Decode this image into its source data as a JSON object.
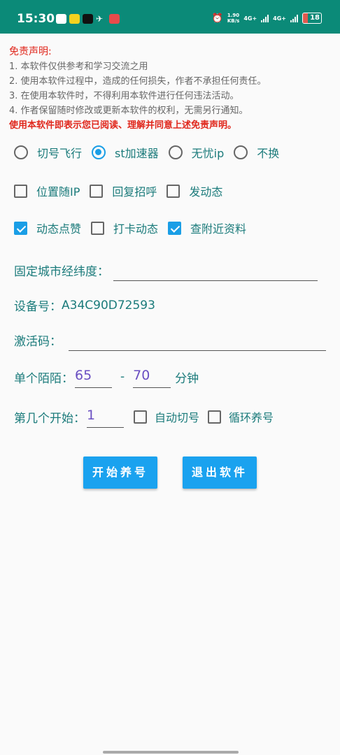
{
  "status_bar": {
    "time": "15:30",
    "speed_value": "1.90",
    "speed_unit": "KB/s",
    "net1": "4G+",
    "net2": "4G+",
    "battery": "18",
    "notif_icons": [
      "qq-icon",
      "app-icon",
      "tiktok-icon",
      "plane-icon",
      "heart-app-icon"
    ]
  },
  "disclaimer": {
    "title": "免责声明:",
    "lines": [
      "1. 本软件仅供参考和学习交流之用",
      "2. 使用本软件过程中，造成的任何损失，作者不承担任何责任。",
      "3. 在使用本软件时，不得利用本软件进行任何违法活动。",
      "4. 作者保留随时修改或更新本软件的权利，无需另行通知。"
    ],
    "warning": "使用本软件即表示您已阅读、理解并同意上述免责声明。"
  },
  "radios": [
    {
      "label": "切号飞行",
      "checked": false
    },
    {
      "label": "st加速器",
      "checked": true
    },
    {
      "label": "无忧ip",
      "checked": false
    },
    {
      "label": "不换",
      "checked": false
    }
  ],
  "checks_row1": [
    {
      "label": "位置随IP",
      "checked": false
    },
    {
      "label": "回复招呼",
      "checked": false
    },
    {
      "label": "发动态",
      "checked": false
    }
  ],
  "checks_row2": [
    {
      "label": "动态点赞",
      "checked": true
    },
    {
      "label": "打卡动态",
      "checked": false
    },
    {
      "label": "查附近资料",
      "checked": true
    }
  ],
  "city": {
    "label": "固定城市经纬度：",
    "value": ""
  },
  "device": {
    "label": "设备号：",
    "value": "A34C90D72593"
  },
  "activation": {
    "label": "激活码：",
    "value": ""
  },
  "duration": {
    "label": "单个陌陌：",
    "min": "65",
    "dash": "-",
    "max": "70",
    "unit": "分钟"
  },
  "start": {
    "label": "第几个开始：",
    "value": "1",
    "auto_switch": "自动切号",
    "auto_checked": false,
    "loop": "循环养号",
    "loop_checked": false
  },
  "buttons": {
    "start": "开始养号",
    "exit": "退出软件"
  },
  "colors": {
    "status_bar": "#0b8a78",
    "accent": "#1a9ee6",
    "label": "#1b7b7b",
    "warning": "#e0271c"
  }
}
